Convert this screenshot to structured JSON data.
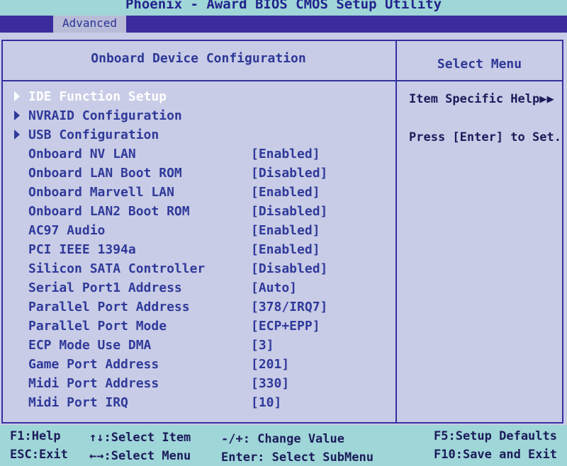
{
  "app": {
    "title": "Phoenix - Award BIOS CMOS Setup Utility"
  },
  "tabs": [
    {
      "label": "Advanced"
    }
  ],
  "panel": {
    "title": "Onboard Device Configuration"
  },
  "help": {
    "title": "Select Menu",
    "line1": "Item Specific Help▶▶",
    "line2": "Press [Enter] to Set."
  },
  "submenus": [
    {
      "label": "IDE Function Setup"
    },
    {
      "label": "NVRAID Configuration"
    },
    {
      "label": "USB Configuration"
    }
  ],
  "settings": [
    {
      "label": "Onboard NV LAN",
      "value": "[Enabled]"
    },
    {
      "label": "Onboard LAN Boot ROM",
      "value": "[Disabled]"
    },
    {
      "label": "Onboard Marvell LAN",
      "value": "[Enabled]"
    },
    {
      "label": "Onboard LAN2 Boot ROM",
      "value": "[Disabled]"
    },
    {
      "label": "AC97 Audio",
      "value": "[Enabled]"
    },
    {
      "label": "PCI IEEE 1394a",
      "value": "[Enabled]"
    },
    {
      "label": "Silicon SATA Controller",
      "value": "[Disabled]"
    },
    {
      "label": "Serial Port1 Address",
      "value": "[Auto]"
    },
    {
      "label": "Parallel Port Address",
      "value": "[378/IRQ7]"
    },
    {
      "label": "Parallel Port Mode",
      "value": "[ECP+EPP]"
    },
    {
      "label": "ECP Mode Use DMA",
      "value": "[3]"
    },
    {
      "label": "Game Port Address",
      "value": "[201]"
    },
    {
      "label": "Midi Port Address",
      "value": "[330]"
    },
    {
      "label": "Midi Port IRQ",
      "value": "[10]"
    }
  ],
  "footer": {
    "f1": "F1:Help",
    "esc": "ESC:Exit",
    "select_item": "↑↓:Select Item",
    "select_menu": "←→:Select Menu",
    "change_value": "-/+: Change Value",
    "enter": "Enter: Select SubMenu",
    "f5": "F5:Setup Defaults",
    "f10": "F10:Save and Exit"
  },
  "colors": {
    "background": "#c9cce6",
    "title_bar": "#9fd6d8",
    "tab_strip": "#3b2c9e",
    "text": "#2f3a9a",
    "highlight": "#ffffff"
  }
}
